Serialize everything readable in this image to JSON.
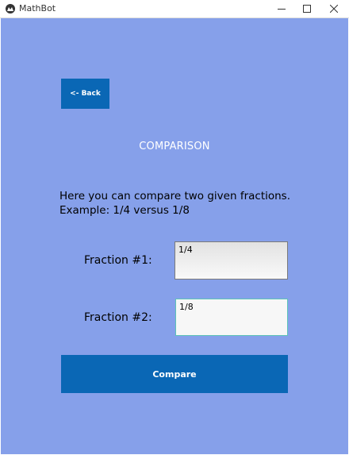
{
  "window": {
    "title": "MathBot",
    "background_color": "#86a0ea",
    "accent_color": "#0a67b5"
  },
  "toolbar": {
    "back_label": "<- Back"
  },
  "main": {
    "heading": "COMPARISON",
    "description_line1": "Here you can compare two given fractions.",
    "description_line2": "Example: 1/4 versus 1/8",
    "fraction1_label": "Fraction #1:",
    "fraction1_value": "1/4",
    "fraction2_label": "Fraction #2:",
    "fraction2_value": "1/8",
    "compare_label": "Compare"
  }
}
